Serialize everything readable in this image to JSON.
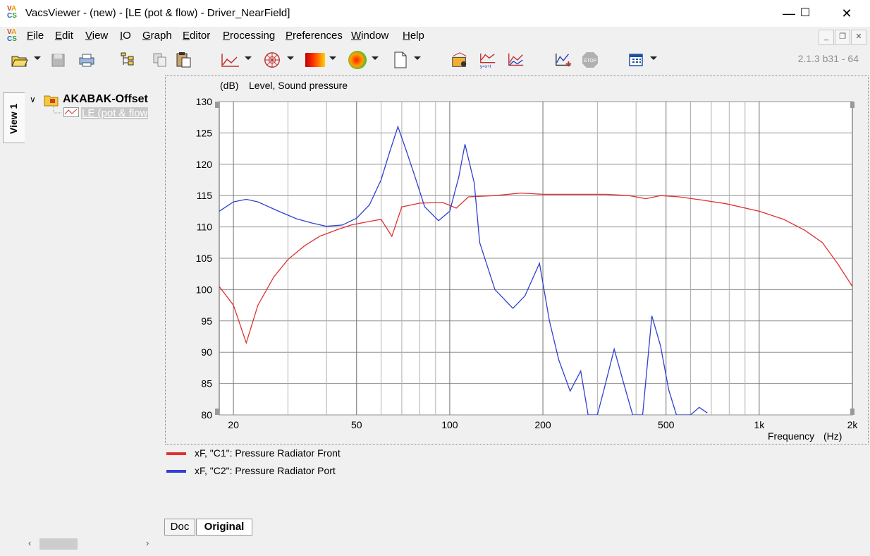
{
  "window": {
    "title": "VacsViewer - (new) - [LE (pot & flow) - Driver_NearField]",
    "logo_text": "VACS",
    "minimize_label": "—",
    "maximize_label": "☐",
    "close_label": "✕"
  },
  "menu": {
    "items": [
      {
        "accel": "F",
        "rest": "ile"
      },
      {
        "accel": "E",
        "rest": "dit"
      },
      {
        "accel": "V",
        "rest": "iew"
      },
      {
        "accel": "I",
        "rest": "O"
      },
      {
        "accel": "G",
        "rest": "raph"
      },
      {
        "accel": "E",
        "rest": "ditor"
      },
      {
        "accel": "P",
        "rest": "rocessing"
      },
      {
        "accel": "P",
        "rest": "references"
      },
      {
        "accel": "W",
        "rest": "indow"
      },
      {
        "accel": "H",
        "rest": "elp"
      }
    ]
  },
  "toolbar": {
    "icons": [
      "open-icon",
      "save-icon",
      "print-icon",
      "tree-icon",
      "copy-icon",
      "paste-icon",
      "graph-type-icon",
      "polar-icon",
      "color-map-icon",
      "sphere-icon",
      "page-icon",
      "export-icon",
      "formula-icon",
      "overlay-icon",
      "step-icon",
      "stop-icon",
      "grid-view-icon"
    ],
    "version": "2.1.3 b31 - 64"
  },
  "tree": {
    "view_tab": "View 1",
    "root": "AKABAK-Offset",
    "child": "LE (pot & flow"
  },
  "graph": {
    "unit_label": "(dB)",
    "quantity_label": "Level, Sound pressure",
    "x_axis_label": "Frequency",
    "x_unit_label": "(Hz)"
  },
  "legend": [
    {
      "label": "xF, \"C1\": Pressure  Radiator Front",
      "color": "#e03030"
    },
    {
      "label": "xF, \"C2\": Pressure  Radiator Port",
      "color": "#3040d0"
    }
  ],
  "tabs": {
    "doc": "Doc",
    "original": "Original"
  },
  "chart_data": {
    "type": "line",
    "x_scale": "log",
    "xlim": [
      18,
      2000
    ],
    "ylim": [
      80,
      130
    ],
    "y_ticks": [
      130,
      125,
      120,
      115,
      110,
      105,
      100,
      95,
      90,
      85,
      80
    ],
    "x_ticks": [
      20,
      50,
      100,
      200,
      500,
      1000,
      2000
    ],
    "x_tick_labels": [
      "20",
      "50",
      "100",
      "200",
      "500",
      "1k",
      "2k"
    ],
    "grid": true,
    "series": [
      {
        "name": "xF, \"C1\": Pressure  Radiator Front",
        "color": "#e03030",
        "points": [
          [
            18,
            100.5
          ],
          [
            20,
            97.5
          ],
          [
            22,
            91.5
          ],
          [
            24,
            97.5
          ],
          [
            27,
            102
          ],
          [
            30,
            104.8
          ],
          [
            34,
            107
          ],
          [
            38,
            108.5
          ],
          [
            43,
            109.5
          ],
          [
            48,
            110.3
          ],
          [
            54,
            110.8
          ],
          [
            60,
            111.2
          ],
          [
            65,
            108.5
          ],
          [
            70,
            113.2
          ],
          [
            80,
            113.8
          ],
          [
            95,
            113.9
          ],
          [
            105,
            113
          ],
          [
            115,
            114.8
          ],
          [
            140,
            115
          ],
          [
            170,
            115.4
          ],
          [
            200,
            115.2
          ],
          [
            250,
            115.2
          ],
          [
            320,
            115.2
          ],
          [
            380,
            115
          ],
          [
            430,
            114.5
          ],
          [
            480,
            115
          ],
          [
            550,
            114.8
          ],
          [
            650,
            114.3
          ],
          [
            780,
            113.7
          ],
          [
            1000,
            112.5
          ],
          [
            1200,
            111.2
          ],
          [
            1400,
            109.5
          ],
          [
            1600,
            107.5
          ],
          [
            1800,
            104
          ],
          [
            2000,
            100.5
          ]
        ]
      },
      {
        "name": "xF, \"C2\": Pressure  Radiator Port",
        "color": "#3040d0",
        "points": [
          [
            18,
            112.5
          ],
          [
            20,
            114
          ],
          [
            22,
            114.4
          ],
          [
            24,
            114
          ],
          [
            28,
            112.5
          ],
          [
            32,
            111.3
          ],
          [
            36,
            110.6
          ],
          [
            40,
            110.1
          ],
          [
            45,
            110.3
          ],
          [
            50,
            111.4
          ],
          [
            55,
            113.5
          ],
          [
            60,
            117.5
          ],
          [
            64,
            122
          ],
          [
            68,
            126
          ],
          [
            72,
            122.5
          ],
          [
            77,
            118.2
          ],
          [
            83,
            113.2
          ],
          [
            92,
            111
          ],
          [
            100,
            112.5
          ],
          [
            107,
            118
          ],
          [
            112,
            123.2
          ],
          [
            120,
            117
          ],
          [
            125,
            107.5
          ],
          [
            140,
            100
          ],
          [
            160,
            97
          ],
          [
            175,
            99
          ],
          [
            195,
            104.2
          ],
          [
            210,
            95
          ],
          [
            225,
            88.8
          ],
          [
            245,
            83.8
          ],
          [
            265,
            87
          ],
          [
            280,
            80
          ],
          [
            300,
            80
          ],
          [
            315,
            84
          ],
          [
            340,
            90.5
          ],
          [
            365,
            85
          ],
          [
            390,
            80
          ],
          [
            420,
            80
          ],
          [
            450,
            95.8
          ],
          [
            480,
            91
          ],
          [
            510,
            84
          ],
          [
            540,
            80
          ],
          [
            600,
            80
          ],
          [
            640,
            81.2
          ],
          [
            680,
            80.3
          ]
        ]
      }
    ]
  }
}
